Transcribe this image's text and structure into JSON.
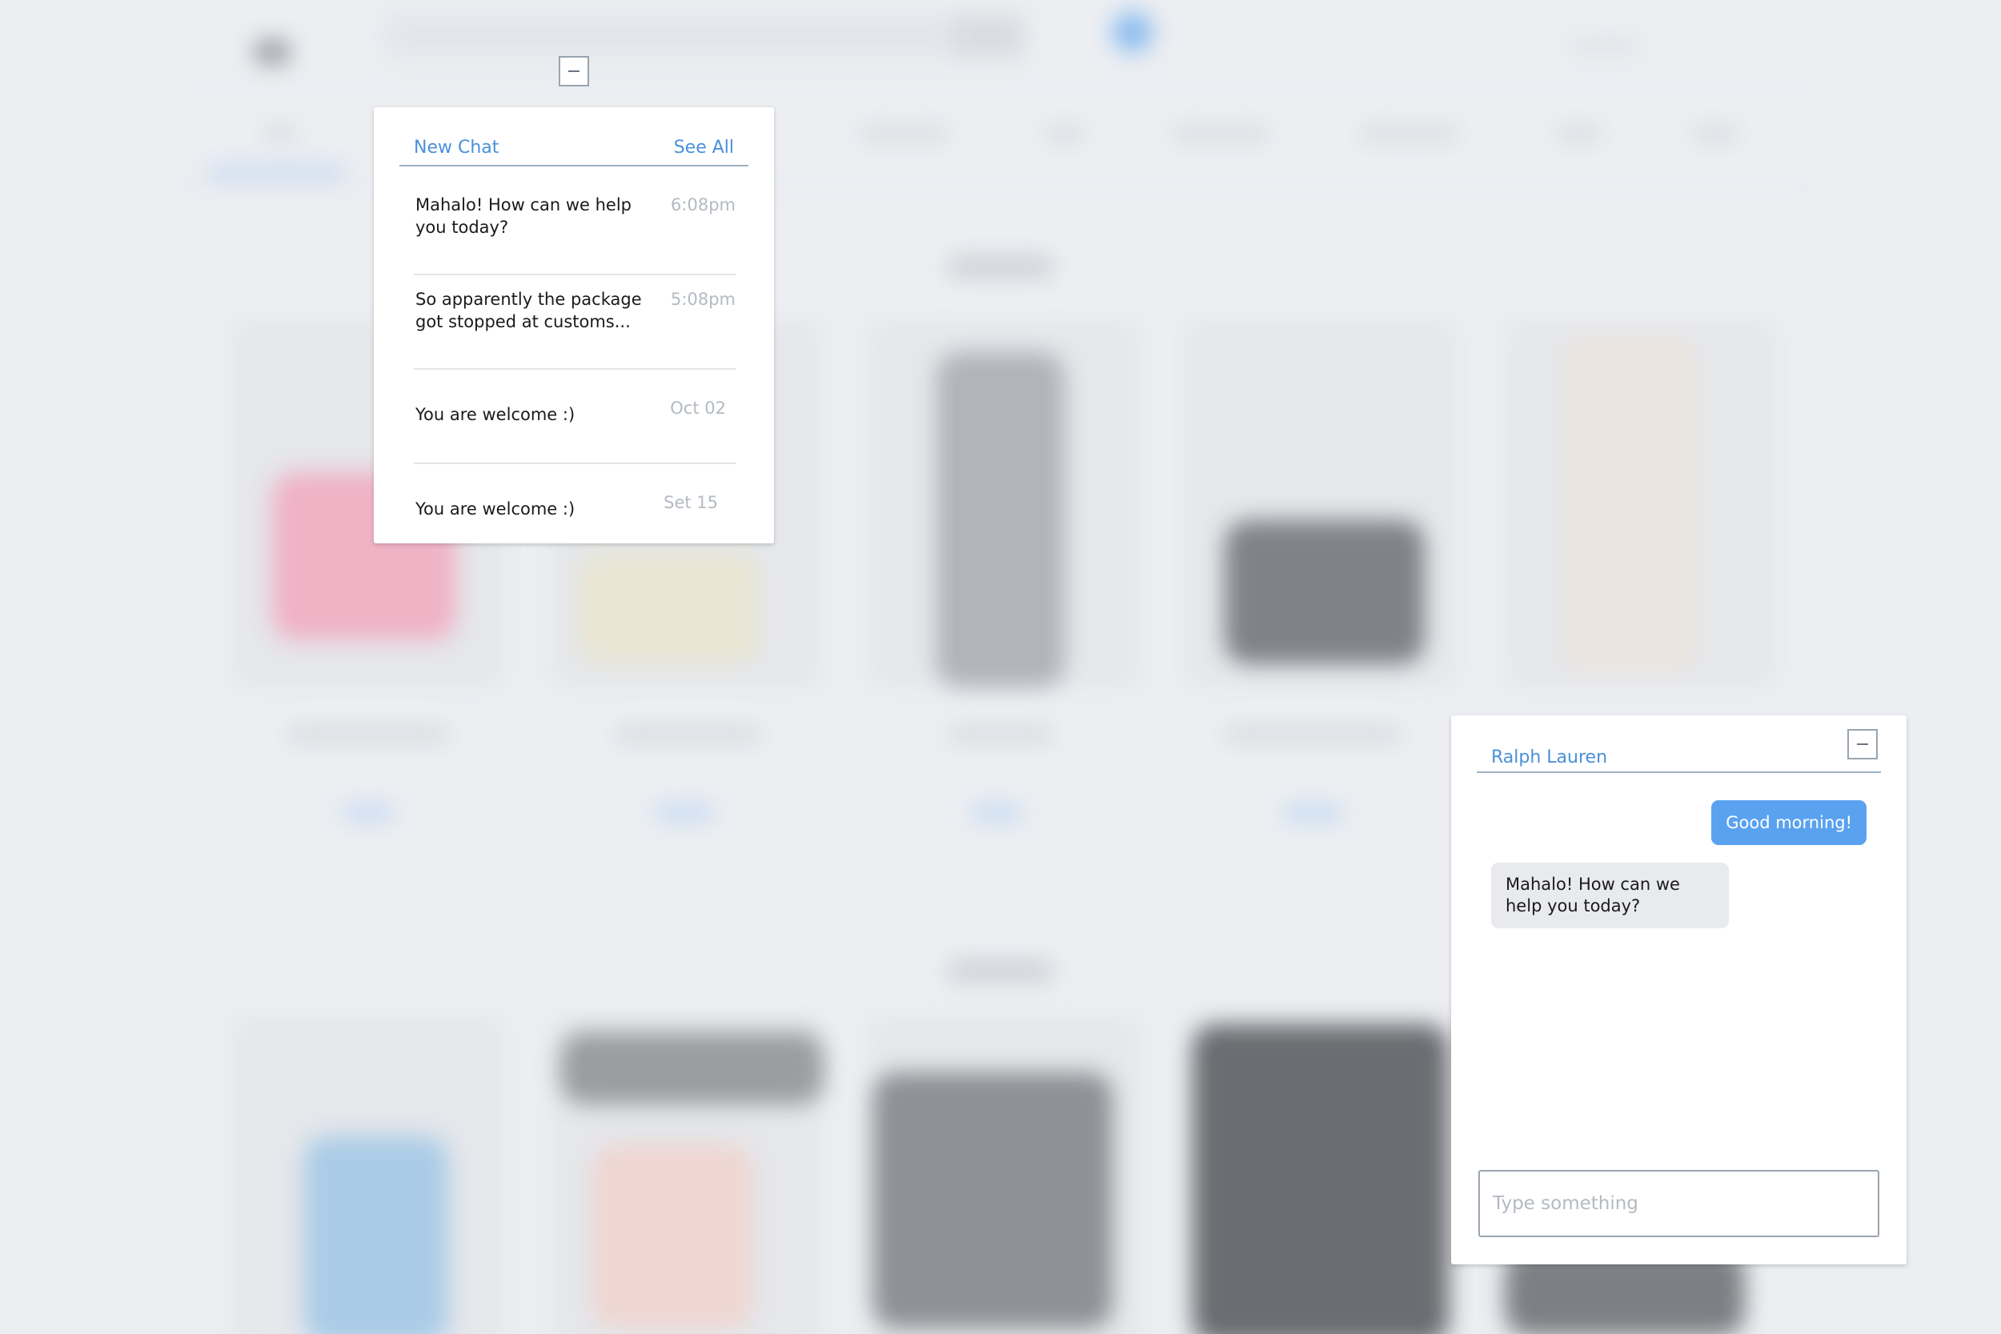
{
  "chat_list": {
    "new_chat_label": "New Chat",
    "see_all_label": "See All",
    "conversations": [
      {
        "message": "Mahalo! How can we help you today?",
        "time": "6:08pm"
      },
      {
        "message": "So apparently the package got stopped at customs...",
        "time": "5:08pm"
      },
      {
        "message": "You are welcome :)",
        "time": "Oct 02"
      },
      {
        "message": "You are welcome :)",
        "time": "Set 15"
      }
    ]
  },
  "conversation": {
    "contact_name": "Ralph Lauren",
    "messages": [
      {
        "direction": "outgoing",
        "text": "Good morning!"
      },
      {
        "direction": "incoming",
        "text": "Mahalo! How can we help you today?"
      }
    ],
    "input_placeholder": "Type something"
  },
  "colors": {
    "accent": "#4a90d9",
    "outgoing_bubble": "#5aa2ef",
    "incoming_bubble": "#e9eaed",
    "muted_text": "#b4bac2"
  },
  "icons": {
    "minimize": "minimize-icon"
  }
}
